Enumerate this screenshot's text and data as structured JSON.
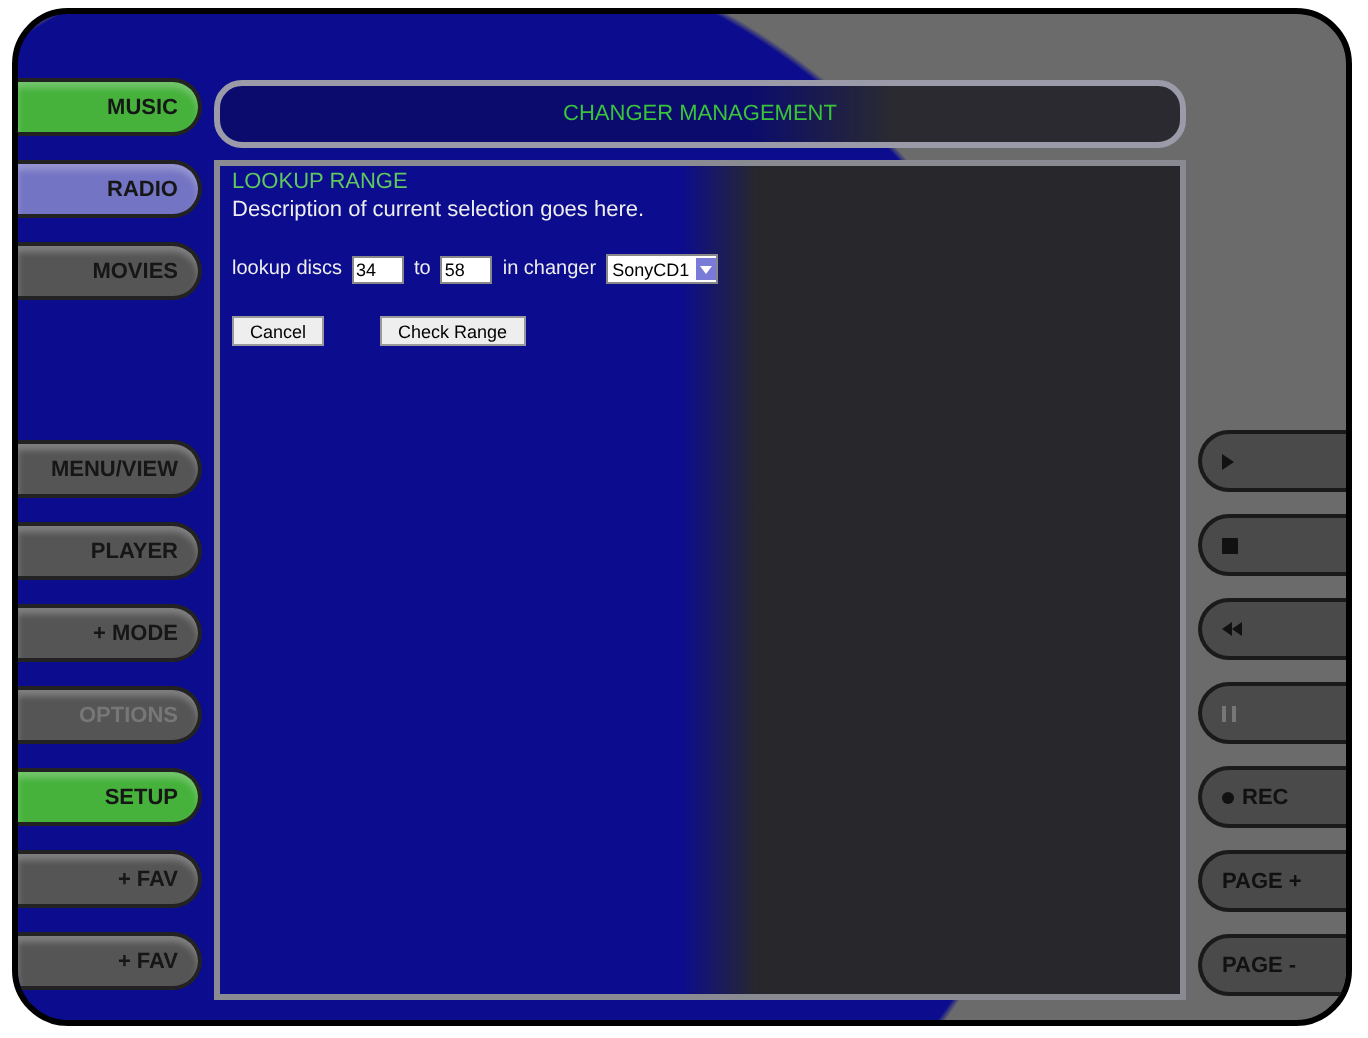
{
  "left_buttons": [
    {
      "label": "MUSIC",
      "color": "#46b23c",
      "disabled": false
    },
    {
      "label": "RADIO",
      "color": "#7474c4",
      "disabled": false
    },
    {
      "label": "MOVIES",
      "color": "#555555",
      "disabled": false
    }
  ],
  "left_buttons_lower": [
    {
      "label": "MENU/VIEW",
      "color": "#555555",
      "disabled": false
    },
    {
      "label": "PLAYER",
      "color": "#555555",
      "disabled": false
    },
    {
      "label": "+ MODE",
      "color": "#555555",
      "disabled": false
    },
    {
      "label": "OPTIONS",
      "color": "#555555",
      "disabled": true
    },
    {
      "label": "SETUP",
      "color": "#46b23c",
      "disabled": false
    },
    {
      "label": "+ FAV",
      "color": "#555555",
      "disabled": false
    },
    {
      "label": "+ FAV",
      "color": "#555555",
      "disabled": false
    }
  ],
  "title": "CHANGER MANAGEMENT",
  "panel": {
    "heading": "LOOKUP RANGE",
    "description": "Description of current selection goes here.",
    "form": {
      "label_1": "lookup discs",
      "from": "34",
      "label_2": "to",
      "to": "58",
      "label_3": "in changer",
      "changer": "SonyCD1"
    },
    "buttons": [
      "Cancel",
      "Check Range"
    ]
  },
  "right_buttons": [
    {
      "kind": "play",
      "disabled": false
    },
    {
      "kind": "stop",
      "disabled": false
    },
    {
      "kind": "rewind",
      "disabled": false
    },
    {
      "kind": "pause",
      "disabled": true
    },
    {
      "kind": "record",
      "label": "REC",
      "disabled": false
    },
    {
      "kind": "text",
      "label": "PAGE +",
      "disabled": false
    },
    {
      "kind": "text",
      "label": "PAGE -",
      "disabled": false
    }
  ]
}
